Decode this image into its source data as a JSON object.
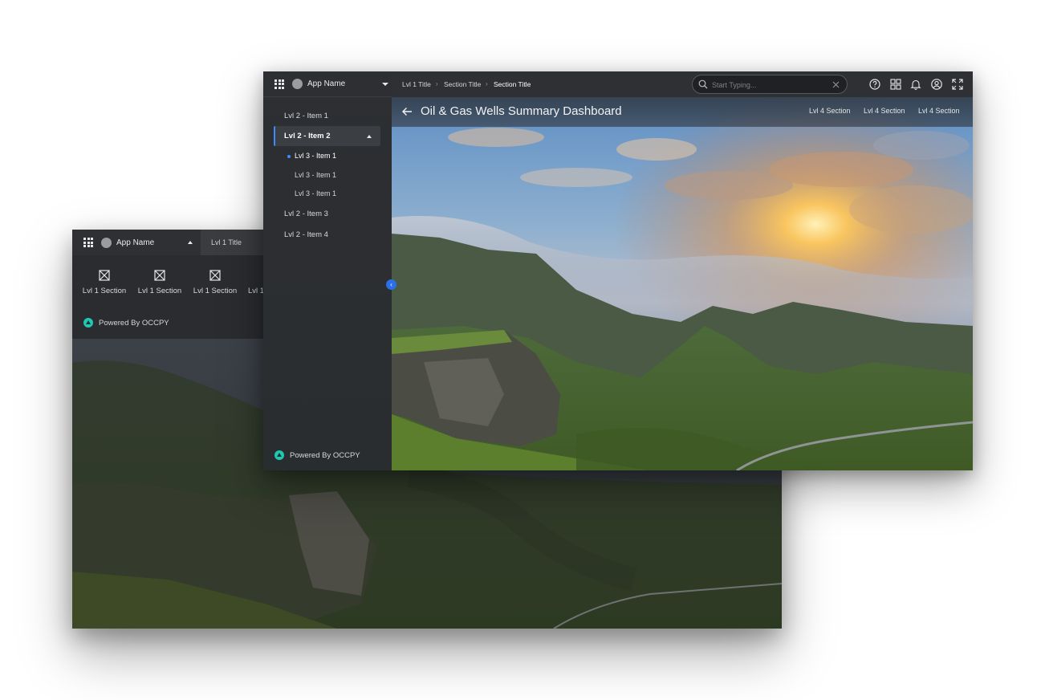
{
  "back_window": {
    "app_name": "App Name",
    "tab": "Lvl 1 Title",
    "sections": [
      "Lvl 1 Section",
      "Lvl 1 Section",
      "Lvl 1 Section",
      "Lvl 1"
    ],
    "powered_by": "Powered By OCCPY"
  },
  "front_window": {
    "app_name": "App Name",
    "sidebar": {
      "items": [
        {
          "label": "Lvl 2 - Item 1"
        },
        {
          "label": "Lvl 2 - Item 2",
          "expanded": true
        },
        {
          "label": "Lvl 2 - Item 3"
        },
        {
          "label": "Lvl 2 - Item 4"
        }
      ],
      "subitems": [
        "Lvl 3 - Item 1",
        "Lvl 3 - Item 1",
        "Lvl 3 - Item 1"
      ],
      "powered_by": "Powered By OCCPY"
    },
    "breadcrumb": [
      "Lvl 1 Title",
      "Section Title",
      "Section Title"
    ],
    "search": {
      "placeholder": "Start Typing..."
    },
    "page_title": "Oil & Gas Wells Summary Dashboard",
    "lvl4_sections": [
      "Lvl 4 Section",
      "Lvl 4 Section",
      "Lvl 4 Section"
    ],
    "top_icons": [
      "help-icon",
      "grid-view-icon",
      "bell-icon",
      "user-icon",
      "fullscreen-icon"
    ]
  },
  "colors": {
    "accent": "#3d8bff",
    "occpy_brand": "#1fc8b0",
    "chrome_dark": "#2c2e32"
  }
}
